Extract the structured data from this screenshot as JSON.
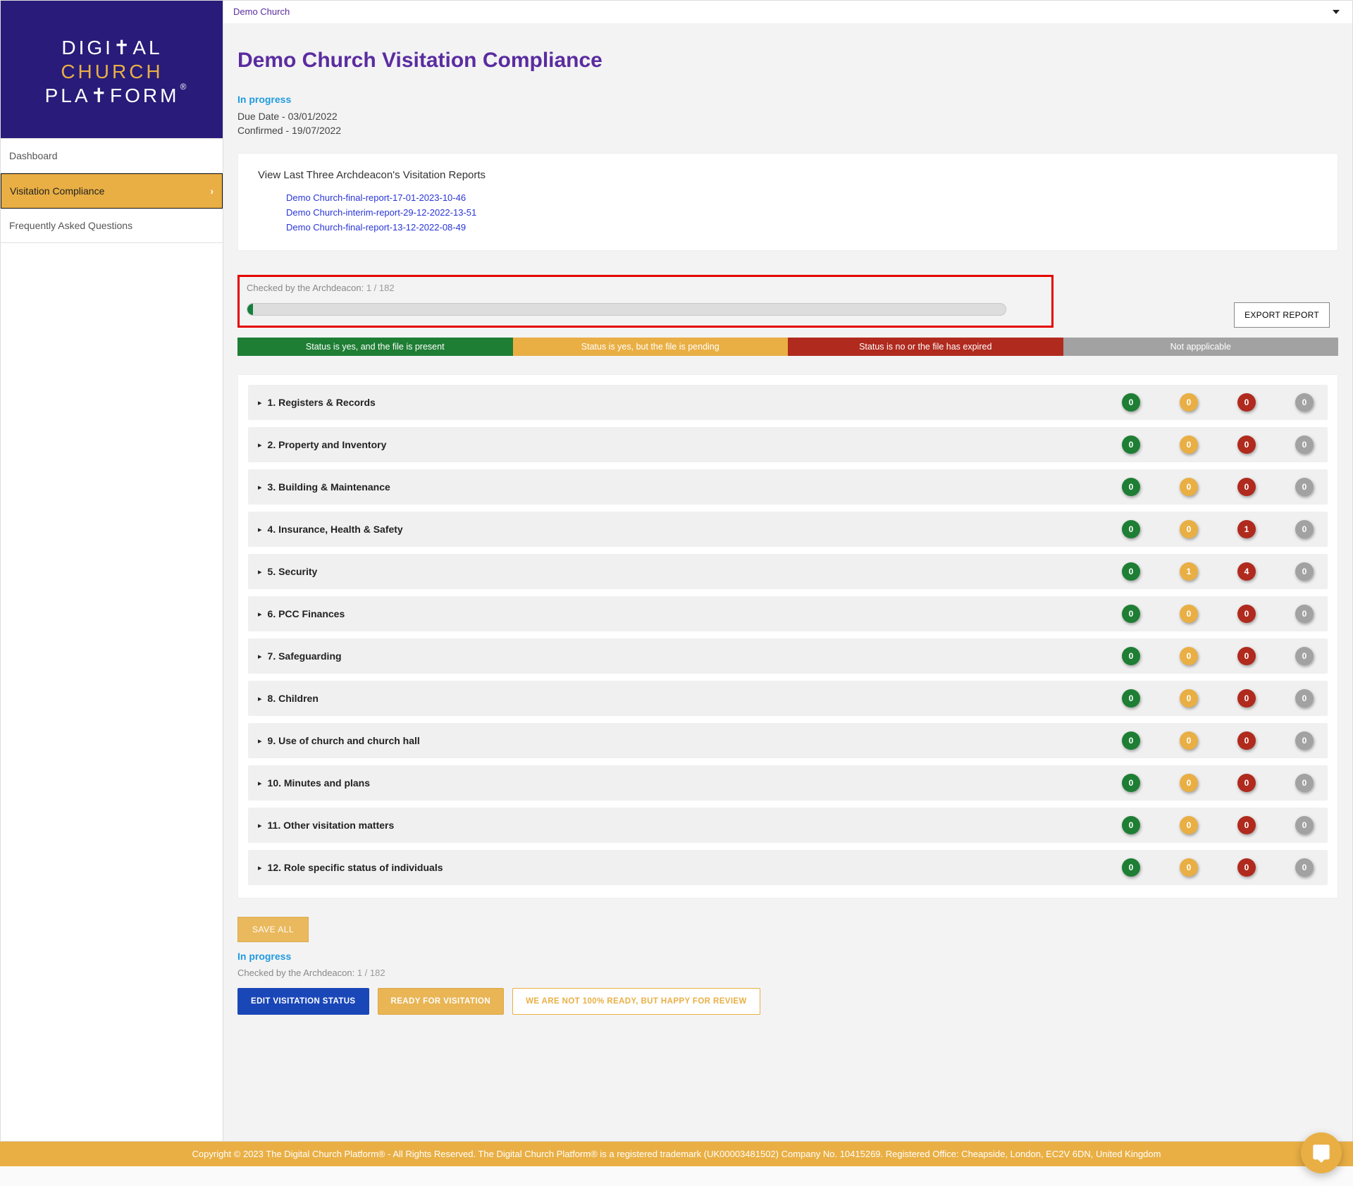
{
  "logo_lines": [
    "DIGI✝AL",
    "CHURCH",
    "PLA✝FORM"
  ],
  "sidebar": {
    "items": [
      "Dashboard",
      "Visitation Compliance",
      "Frequently Asked Questions"
    ],
    "active_index": 1
  },
  "breadcrumb": "Demo Church",
  "page_title": "Demo Church Visitation Compliance",
  "status_text": "In progress",
  "due_date_label": "Due Date - 03/01/2022",
  "confirmed_label": "Confirmed - 19/07/2022",
  "reports": {
    "heading": "View Last Three Archdeacon's Visitation Reports",
    "items": [
      "Demo Church-final-report-17-01-2023-10-46",
      "Demo Church-interim-report-29-12-2022-13-51",
      "Demo Church-final-report-13-12-2022-08-49"
    ]
  },
  "progress": {
    "label_prefix": "Checked by the Archdeacon: ",
    "count_text": "1 / 182"
  },
  "export_button": "EXPORT REPORT",
  "legend": {
    "green": "Status is yes, and the file is present",
    "yellow": "Status is yes, but the file is pending",
    "red": "Status is no or the file has expired",
    "grey": "Not appplicable"
  },
  "sections": [
    {
      "label": "1. Registers & Records",
      "green": 0,
      "yellow": 0,
      "red": 0,
      "grey": 0
    },
    {
      "label": "2. Property and Inventory",
      "green": 0,
      "yellow": 0,
      "red": 0,
      "grey": 0
    },
    {
      "label": "3. Building & Maintenance",
      "green": 0,
      "yellow": 0,
      "red": 0,
      "grey": 0
    },
    {
      "label": "4. Insurance, Health & Safety",
      "green": 0,
      "yellow": 0,
      "red": 1,
      "grey": 0
    },
    {
      "label": "5. Security",
      "green": 0,
      "yellow": 1,
      "red": 4,
      "grey": 0
    },
    {
      "label": "6. PCC Finances",
      "green": 0,
      "yellow": 0,
      "red": 0,
      "grey": 0
    },
    {
      "label": "7. Safeguarding",
      "green": 0,
      "yellow": 0,
      "red": 0,
      "grey": 0
    },
    {
      "label": "8. Children",
      "green": 0,
      "yellow": 0,
      "red": 0,
      "grey": 0
    },
    {
      "label": "9. Use of church and church hall",
      "green": 0,
      "yellow": 0,
      "red": 0,
      "grey": 0
    },
    {
      "label": "10. Minutes and plans",
      "green": 0,
      "yellow": 0,
      "red": 0,
      "grey": 0
    },
    {
      "label": "11. Other visitation matters",
      "green": 0,
      "yellow": 0,
      "red": 0,
      "grey": 0
    },
    {
      "label": "12. Role specific status of individuals",
      "green": 0,
      "yellow": 0,
      "red": 0,
      "grey": 0
    }
  ],
  "save_all_label": "SAVE ALL",
  "bottom": {
    "status": "In progress",
    "checked_prefix": "Checked by the Archdeacon: ",
    "checked_count": "1 / 182",
    "buttons": {
      "edit": "EDIT VISITATION STATUS",
      "ready": "READY FOR VISITATION",
      "happy": "WE ARE NOT 100% READY, BUT HAPPY FOR REVIEW"
    }
  },
  "footer_text": "Copyright © 2023 The Digital Church Platform® - All Rights Reserved. The Digital Church Platform® is a registered trademark (UK00003481502) Company No. 10415269. Registered Office: Cheapside, London, EC2V 6DN, United Kingdom"
}
